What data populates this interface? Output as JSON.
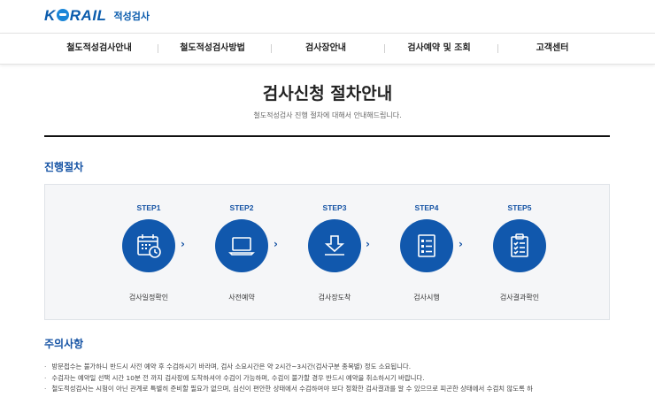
{
  "header": {
    "logo_text": "KORAIL",
    "logo_sub": "적성검사"
  },
  "nav": {
    "items": [
      "철도적성검사안내",
      "철도적성검사방법",
      "검사장안내",
      "검사예약 및 조회",
      "고객센터"
    ]
  },
  "page": {
    "title": "검사신청 절차안내",
    "subtitle": "철도적성검사 진행 절차에 대해서 안내해드립니다."
  },
  "process": {
    "heading": "진행절차",
    "steps": [
      {
        "no": "STEP1",
        "label": "검사일정확인",
        "icon": "calendar-icon"
      },
      {
        "no": "STEP2",
        "label": "사전예약",
        "icon": "laptop-icon"
      },
      {
        "no": "STEP3",
        "label": "검사장도착",
        "icon": "download-arrow-icon"
      },
      {
        "no": "STEP4",
        "label": "검사시행",
        "icon": "checklist-icon"
      },
      {
        "no": "STEP5",
        "label": "검사결과확인",
        "icon": "clipboard-icon"
      }
    ],
    "arrow_glyph": "›"
  },
  "notice": {
    "heading": "주의사항",
    "items": [
      "방문접수는 불가하니 반드시 사전 예약 후 수검하시기 바라며, 검사 소요시간은 약 2시간~3시간(검사구분 종목별) 정도 소요됩니다.",
      "수검자는 예약일 선택 시간 10분 전 까지 검사장에 도착하셔야 수검이 가능하며, 수검이 불가할 경우 반드시 예약을 취소하시기 바랍니다.",
      "철도적성검사는 시험이 아닌 관계로 특별히 준비할 필요가 없으며, 심신이 편안한 상태에서 수검하여야 보다 정확한 검사결과를 알 수 있으므로 피곤한 상태에서 수검치 않도록 하"
    ]
  },
  "colors": {
    "brand": "#1158ad",
    "heading": "#1553a4",
    "box_bg": "#f5f6f8"
  }
}
